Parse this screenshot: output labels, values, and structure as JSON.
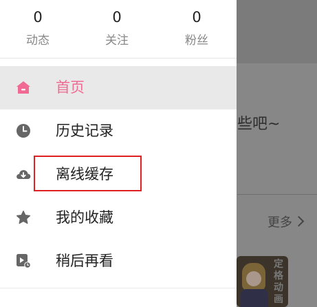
{
  "stats": [
    {
      "value": "0",
      "label": "动态"
    },
    {
      "value": "0",
      "label": "关注"
    },
    {
      "value": "0",
      "label": "粉丝"
    }
  ],
  "menu": [
    {
      "label": "首页",
      "icon": "home-icon",
      "active": true
    },
    {
      "label": "历史记录",
      "icon": "clock-icon"
    },
    {
      "label": "离线缓存",
      "icon": "cloud-download-icon"
    },
    {
      "label": "我的收藏",
      "icon": "star-icon"
    },
    {
      "label": "稍后再看",
      "icon": "watch-later-icon"
    }
  ],
  "background": {
    "text": "些吧~",
    "more_label": "更多",
    "thumb_text": "定格动画"
  },
  "colors": {
    "accent": "#f06a94",
    "highlight": "#e02020",
    "icon": "#666666"
  }
}
